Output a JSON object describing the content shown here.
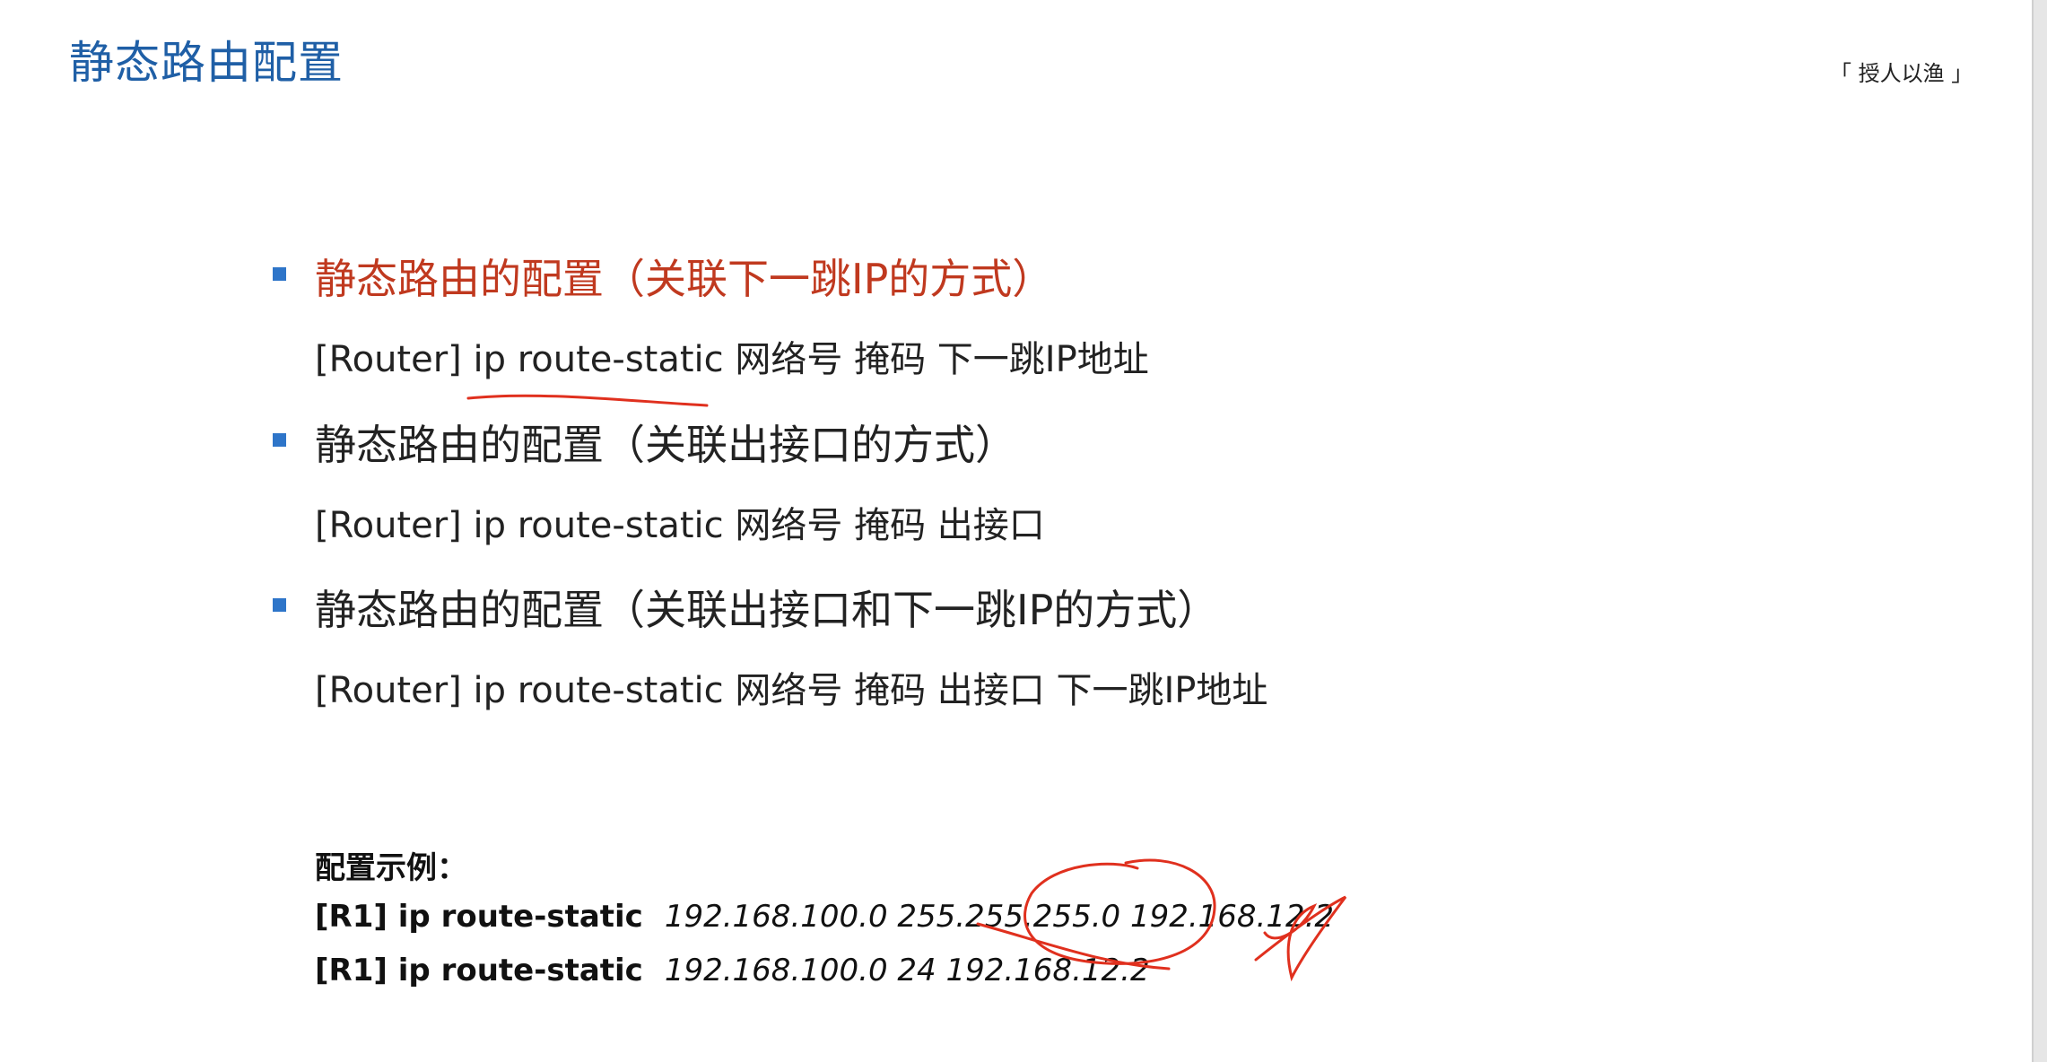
{
  "slide": {
    "title": "静态路由配置",
    "tagline": "「 授人以渔 」",
    "items": [
      {
        "heading": "静态路由的配置（关联下一跳IP的方式）",
        "command": "[Router] ip route-static 网络号 掩码 下一跳IP地址"
      },
      {
        "heading": "静态路由的配置（关联出接口的方式）",
        "command": "[Router] ip route-static 网络号 掩码 出接口"
      },
      {
        "heading": "静态路由的配置（关联出接口和下一跳IP的方式）",
        "command": "[Router] ip route-static 网络号 掩码 出接口 下一跳IP地址"
      }
    ],
    "example": {
      "label": "配置示例：",
      "lines": [
        {
          "prefix": "[R1] ip route-static",
          "args": "192.168.100.0 255.255.255.0 192.168.12.2"
        },
        {
          "prefix": "[R1] ip route-static",
          "args": "192.168.100.0 24 192.168.12.2"
        }
      ]
    }
  },
  "colors": {
    "title": "#1f5fa6",
    "highlight_heading": "#c0391f",
    "bullet": "#2e75c9",
    "annotation_ink": "#e0301e"
  }
}
